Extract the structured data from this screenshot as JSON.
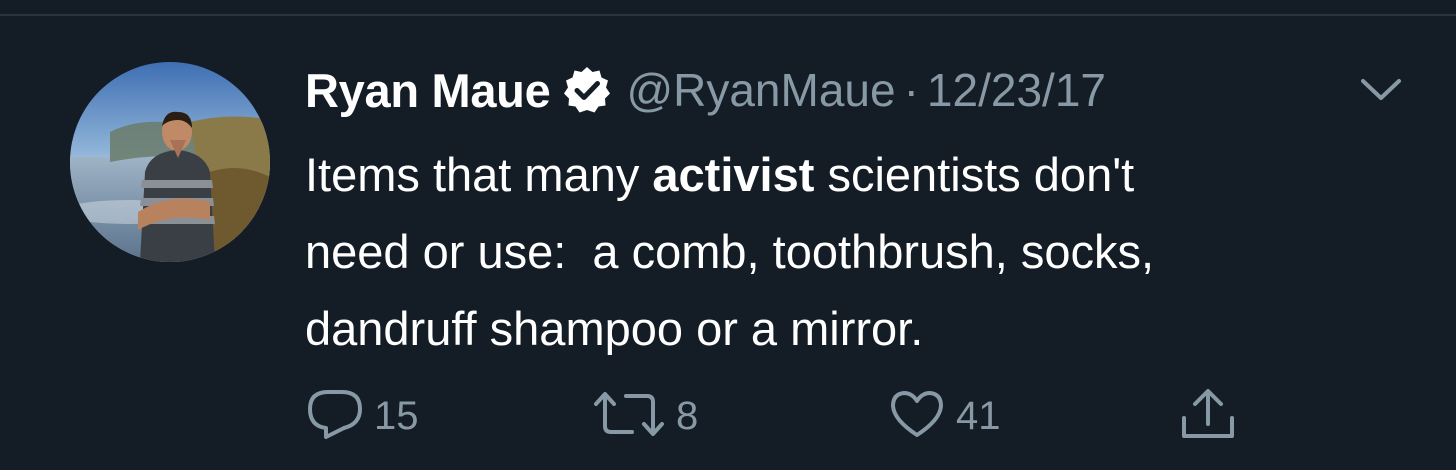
{
  "tweet": {
    "display_name": "Ryan Maue",
    "verified_icon": "verified-badge-icon",
    "handle": "@RyanMaue",
    "separator": "·",
    "date": "12/23/17",
    "text_before": "Items that many ",
    "text_bold": "activist",
    "text_after": " scientists don't\nneed or use:  a comb, toothbrush, socks,\ndandruff shampoo or a mirror."
  },
  "actions": {
    "reply_count": "15",
    "retweet_count": "8",
    "like_count": "41",
    "reply_icon": "reply-icon",
    "retweet_icon": "retweet-icon",
    "like_icon": "heart-icon",
    "share_icon": "share-icon",
    "menu_icon": "chevron-down-icon"
  },
  "colors": {
    "background": "#141d26",
    "text": "#ffffff",
    "secondary": "#8899a6"
  }
}
